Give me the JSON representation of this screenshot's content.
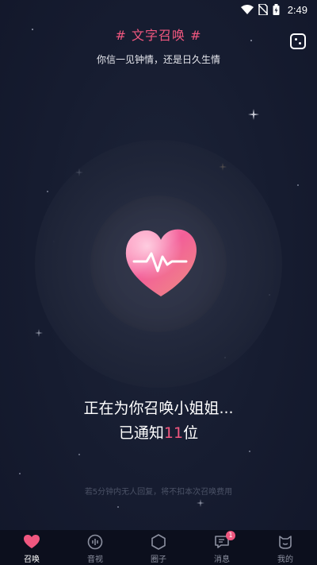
{
  "status_bar": {
    "time": "2:49"
  },
  "header": {
    "title": "# 文字召唤 #",
    "subtitle": "你信一见钟情，还是日久生情"
  },
  "main": {
    "calling_text": "正在为你召唤小姐姐...",
    "notified_prefix": "已通知",
    "notified_count": "11",
    "notified_suffix": "位",
    "note": "若5分钟内无人回复，将不扣本次召唤费用"
  },
  "tabbar": {
    "tabs": [
      {
        "label": "召唤",
        "icon": "heart-icon",
        "active": true
      },
      {
        "label": "音视",
        "icon": "audio-video-icon",
        "active": false
      },
      {
        "label": "圈子",
        "icon": "hexagon-icon",
        "active": false
      },
      {
        "label": "消息",
        "icon": "message-icon",
        "active": false,
        "badge": "1"
      },
      {
        "label": "我的",
        "icon": "cat-face-icon",
        "active": false
      }
    ]
  },
  "colors": {
    "accent": "#f0577f",
    "background": "#141a2e",
    "tabbar": "#0c0f1d"
  }
}
